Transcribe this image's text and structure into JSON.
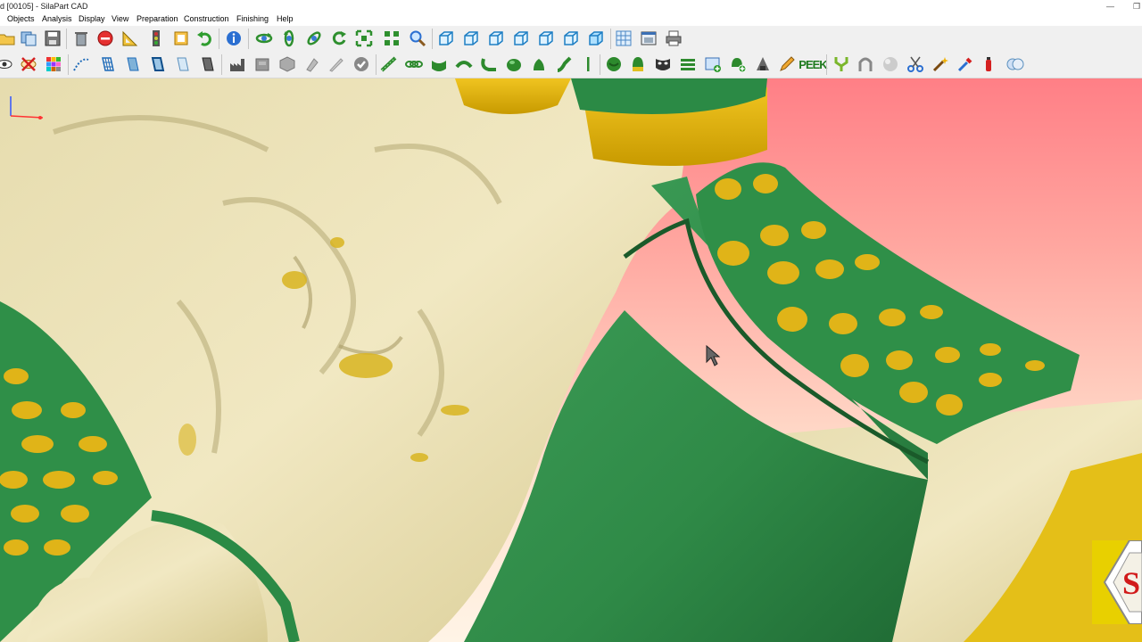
{
  "window": {
    "title": "d [00105] - SilaPart CAD"
  },
  "menu": {
    "items": [
      "Objects",
      "Analysis",
      "Display",
      "View",
      "Preparation",
      "Construction",
      "Finishing",
      "Help"
    ]
  },
  "toolbar2": {
    "peek_label": "PEEK"
  },
  "logo": {
    "letter": "S"
  }
}
